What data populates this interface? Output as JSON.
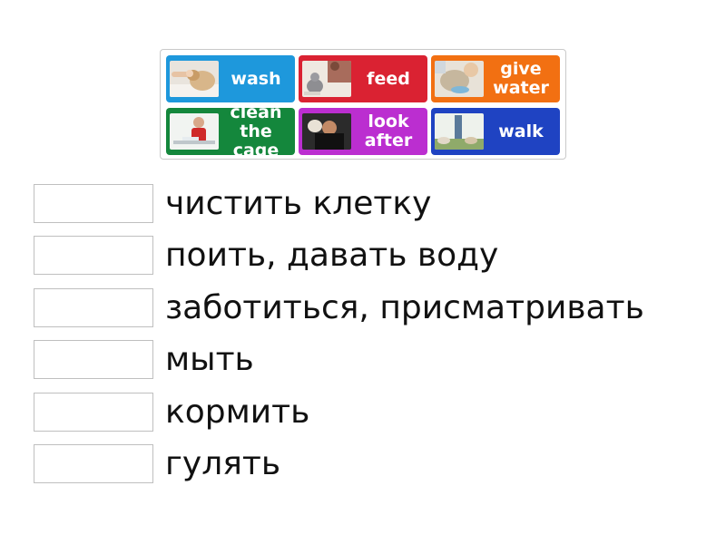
{
  "tiles": [
    {
      "label": "wash",
      "color": "#1e98dc",
      "icon": "washing-pet-photo"
    },
    {
      "label": "feed",
      "color": "#da2232",
      "icon": "feeding-pet-photo"
    },
    {
      "label": "give\nwater",
      "color": "#f27012",
      "icon": "pet-drinking-photo"
    },
    {
      "label": "clean\nthe cage",
      "color": "#14873c",
      "icon": "child-cleaning-cage-photo"
    },
    {
      "label": "look\nafter",
      "color": "#bb2ed0",
      "icon": "caring-for-pet-photo"
    },
    {
      "label": "walk",
      "color": "#1f43c2",
      "icon": "walking-dogs-photo"
    }
  ],
  "definitions": [
    "чистить клетку",
    "поить, давать воду",
    "заботиться, присматривать",
    "мыть",
    "кормить",
    "гулять"
  ]
}
